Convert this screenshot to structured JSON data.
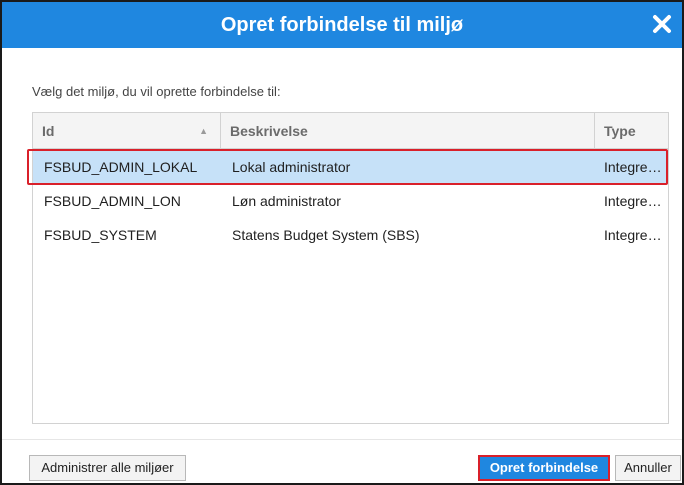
{
  "dialog": {
    "title": "Opret forbindelse til miljø",
    "close_icon": "close-icon",
    "instruction": "Vælg det miljø, du vil oprette forbindelse til:"
  },
  "table": {
    "columns": [
      {
        "label": "Id",
        "sort_icon": "sort-ascending-icon"
      },
      {
        "label": "Beskrivelse"
      },
      {
        "label": "Type"
      }
    ],
    "rows": [
      {
        "id": "FSBUD_ADMIN_LOKAL",
        "desc": "Lokal administrator",
        "type": "Integre…",
        "selected": true
      },
      {
        "id": "FSBUD_ADMIN_LON",
        "desc": "Løn administrator",
        "type": "Integre…",
        "selected": false
      },
      {
        "id": "FSBUD_SYSTEM",
        "desc": "Statens Budget System (SBS)",
        "type": "Integre…",
        "selected": false
      }
    ]
  },
  "footer": {
    "manage_label": "Administrer alle miljøer",
    "connect_label": "Opret forbindelse",
    "cancel_label": "Annuller"
  },
  "colors": {
    "title_bar": "#1f87e0",
    "selected_row": "#c6e1f8",
    "highlight": "#d9202a"
  }
}
